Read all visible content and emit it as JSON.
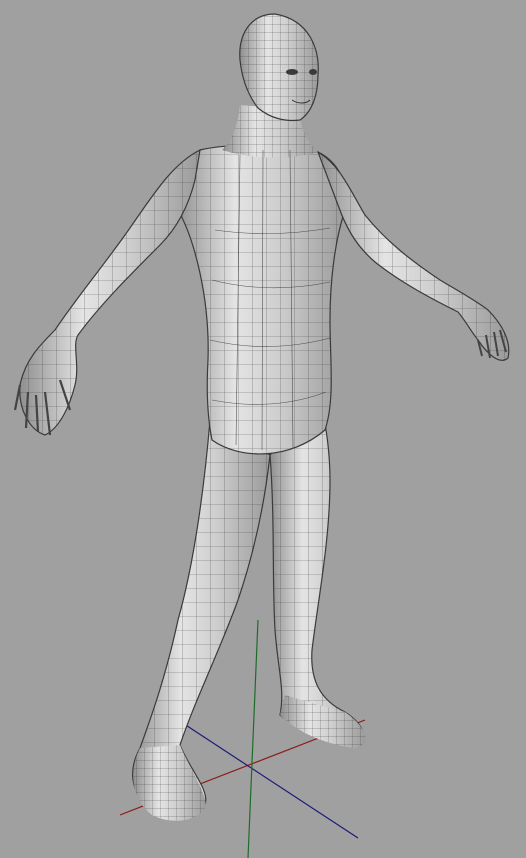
{
  "viewport": {
    "background_color": "#a0a0a0",
    "mesh_base_color": "#d9d9d9",
    "mesh_shadow_color": "#8f8f8f",
    "wire_color": "#2a2a2a"
  },
  "axes_gizmo": {
    "x_axis_color": "#8b1a1a",
    "y_axis_color": "#1f6b2a",
    "z_axis_color": "#1b1b7a"
  }
}
